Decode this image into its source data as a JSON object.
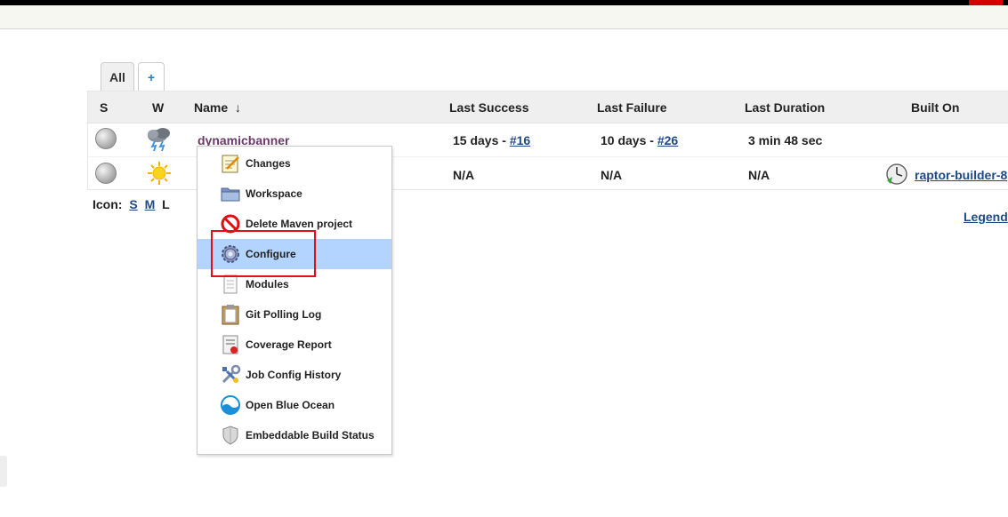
{
  "tabs": {
    "all": "All",
    "add": "+"
  },
  "columns": {
    "s": "S",
    "w": "W",
    "name": "Name",
    "sort_arrow": "↓",
    "last_success": "Last Success",
    "last_failure": "Last Failure",
    "last_duration": "Last Duration",
    "built_on": "Built On"
  },
  "rows": [
    {
      "name": "dynamicbanner",
      "last_success": "15 days - ",
      "last_success_build": "#16",
      "last_failure": "10 days - ",
      "last_failure_build": "#26",
      "last_duration": "3 min 48 sec",
      "built_on": ""
    },
    {
      "name": "",
      "last_success": "N/A",
      "last_failure": "N/A",
      "last_duration": "N/A",
      "built_on": "raptor-builder-8"
    }
  ],
  "icon_size": {
    "label": "Icon:",
    "s": "S",
    "m": "M",
    "l": "L"
  },
  "legend": "Legend",
  "context_menu": [
    {
      "label": "Changes",
      "icon": "notepad-icon"
    },
    {
      "label": "Workspace",
      "icon": "folder-icon"
    },
    {
      "label": "Delete Maven project",
      "icon": "no-entry-icon"
    },
    {
      "label": "Configure",
      "icon": "gear-icon"
    },
    {
      "label": "Modules",
      "icon": "document-icon"
    },
    {
      "label": "Git Polling Log",
      "icon": "clipboard-icon"
    },
    {
      "label": "Coverage Report",
      "icon": "report-icon"
    },
    {
      "label": "Job Config History",
      "icon": "tools-icon"
    },
    {
      "label": "Open Blue Ocean",
      "icon": "blue-ocean-icon"
    },
    {
      "label": "Embeddable Build Status",
      "icon": "shield-icon"
    }
  ],
  "colors": {
    "link": "#204a87",
    "menu_active": "#b3d4ff",
    "highlight": "#e0101a"
  }
}
